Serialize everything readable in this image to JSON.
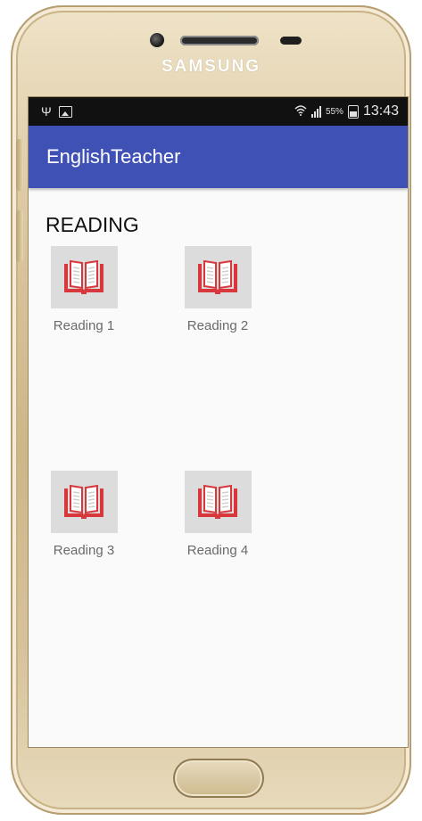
{
  "device": {
    "brand": "SAMSUNG"
  },
  "status_bar": {
    "left_icons": [
      "usb-icon",
      "image-icon"
    ],
    "right_icons": [
      "wifi-icon",
      "signal-icon",
      "battery-icon"
    ],
    "battery": "55%",
    "time": "13:43"
  },
  "app_bar": {
    "title": "EnglishTeacher",
    "color": "#3f51b5"
  },
  "main": {
    "section_title": "READING",
    "items": [
      {
        "label": "Reading 1",
        "icon": "book-icon"
      },
      {
        "label": "Reading 2",
        "icon": "book-icon"
      },
      {
        "label": "Reading 3",
        "icon": "book-icon"
      },
      {
        "label": "Reading 4",
        "icon": "book-icon"
      }
    ]
  },
  "colors": {
    "book_red": "#d8373b",
    "tile_background": "#dcdcdc"
  }
}
